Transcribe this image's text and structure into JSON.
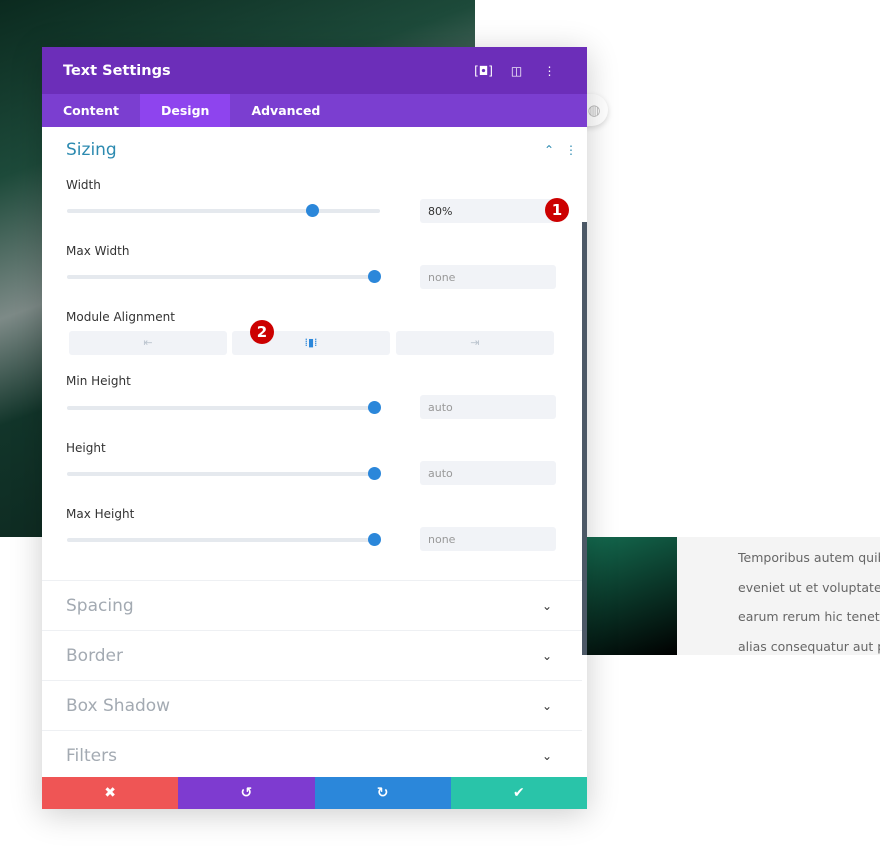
{
  "panel": {
    "title": "Text Settings",
    "header_icons": [
      "fullscreen-icon",
      "split-view-icon",
      "more-icon"
    ],
    "tabs": [
      {
        "label": "Content"
      },
      {
        "label": "Design",
        "active": true
      },
      {
        "label": "Advanced"
      }
    ]
  },
  "sizing": {
    "title": "Sizing",
    "width": {
      "label": "Width",
      "value": "80%",
      "slider_percent": 80
    },
    "max_width": {
      "label": "Max Width",
      "value": "none",
      "slider_percent": 100
    },
    "module_alignment": {
      "label": "Module Alignment",
      "options": [
        "left",
        "center",
        "right"
      ],
      "selected": "center"
    },
    "min_height": {
      "label": "Min Height",
      "value": "auto",
      "slider_percent": 100
    },
    "height": {
      "label": "Height",
      "value": "auto",
      "slider_percent": 100
    },
    "max_height": {
      "label": "Max Height",
      "value": "none",
      "slider_percent": 100
    }
  },
  "badges": [
    "1",
    "2"
  ],
  "sections": [
    "Spacing",
    "Border",
    "Box Shadow",
    "Filters"
  ],
  "footer": {
    "colors": {
      "cancel": "#ef5555",
      "undo": "#7e3bd0",
      "redo": "#2b87da",
      "save": "#29c4a9"
    }
  },
  "page_text": [
    "Temporibus autem quibu",
    "eveniet ut et voluptates r",
    "earum rerum hic tenetur",
    "alias consequatur aut pe"
  ]
}
